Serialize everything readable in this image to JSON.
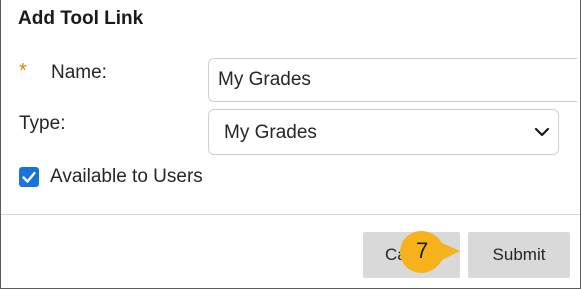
{
  "dialog": {
    "title": "Add Tool Link"
  },
  "form": {
    "required_marker": "*",
    "name_label": "Name:",
    "name_value": "My Grades",
    "type_label": "Type:",
    "type_selected": "My Grades",
    "available_label": "Available to Users",
    "available_checked": true
  },
  "footer": {
    "cancel_label": "Ca",
    "submit_label": "Submit"
  },
  "callout": {
    "step": "7",
    "color": "#f5b21b"
  },
  "colors": {
    "required": "#e27d0f",
    "checkbox": "#1a73d9",
    "button_bg": "#d9d9d9"
  }
}
